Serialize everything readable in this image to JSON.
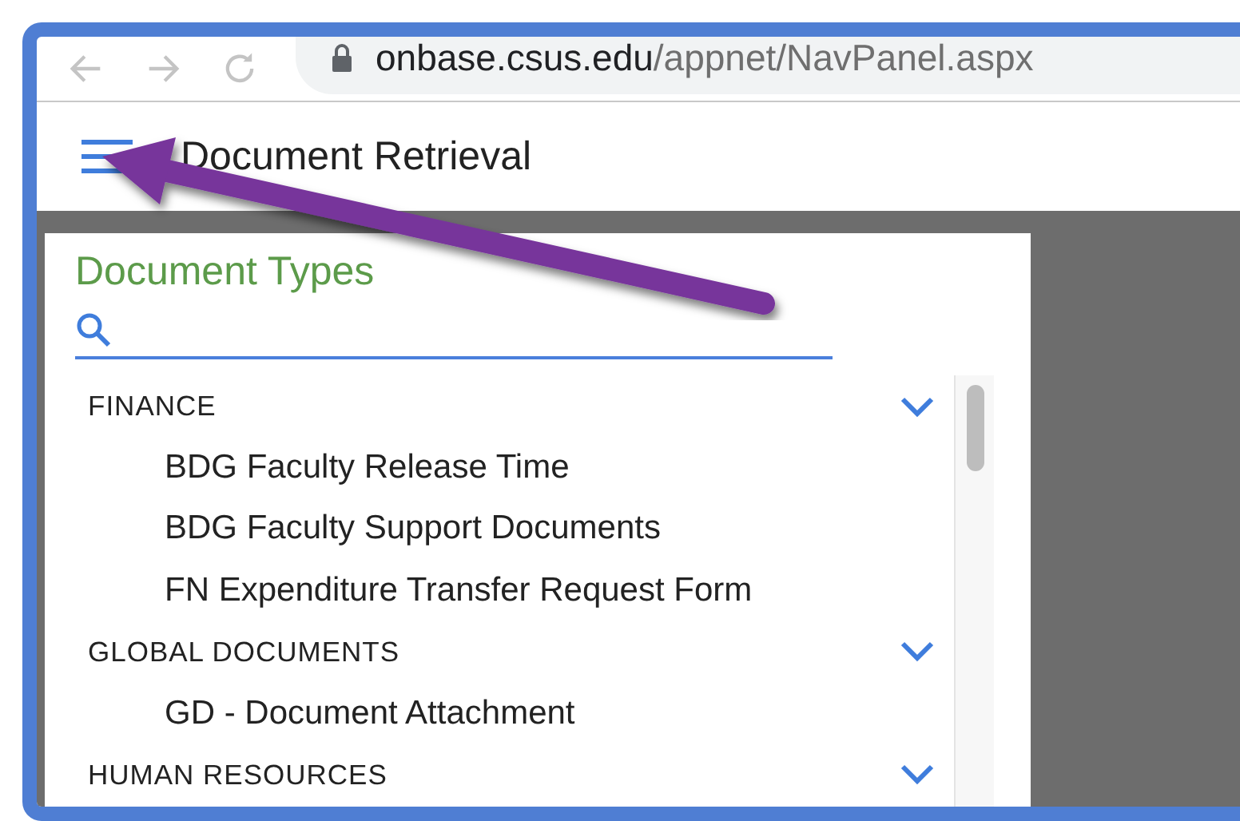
{
  "browser": {
    "url_host": "onbase.csus.edu",
    "url_path": "/appnet/NavPanel.aspx"
  },
  "header": {
    "title": "Document Retrieval"
  },
  "panel": {
    "title": "Document Types",
    "groups": [
      {
        "label": "FINANCE",
        "expanded": true,
        "items": [
          "BDG Faculty Release Time",
          "BDG Faculty Support Documents",
          "FN Expenditure Transfer Request Form"
        ]
      },
      {
        "label": "GLOBAL DOCUMENTS",
        "expanded": true,
        "items": [
          "GD - Document Attachment"
        ]
      },
      {
        "label": "HUMAN RESOURCES",
        "expanded": true
      }
    ]
  }
}
